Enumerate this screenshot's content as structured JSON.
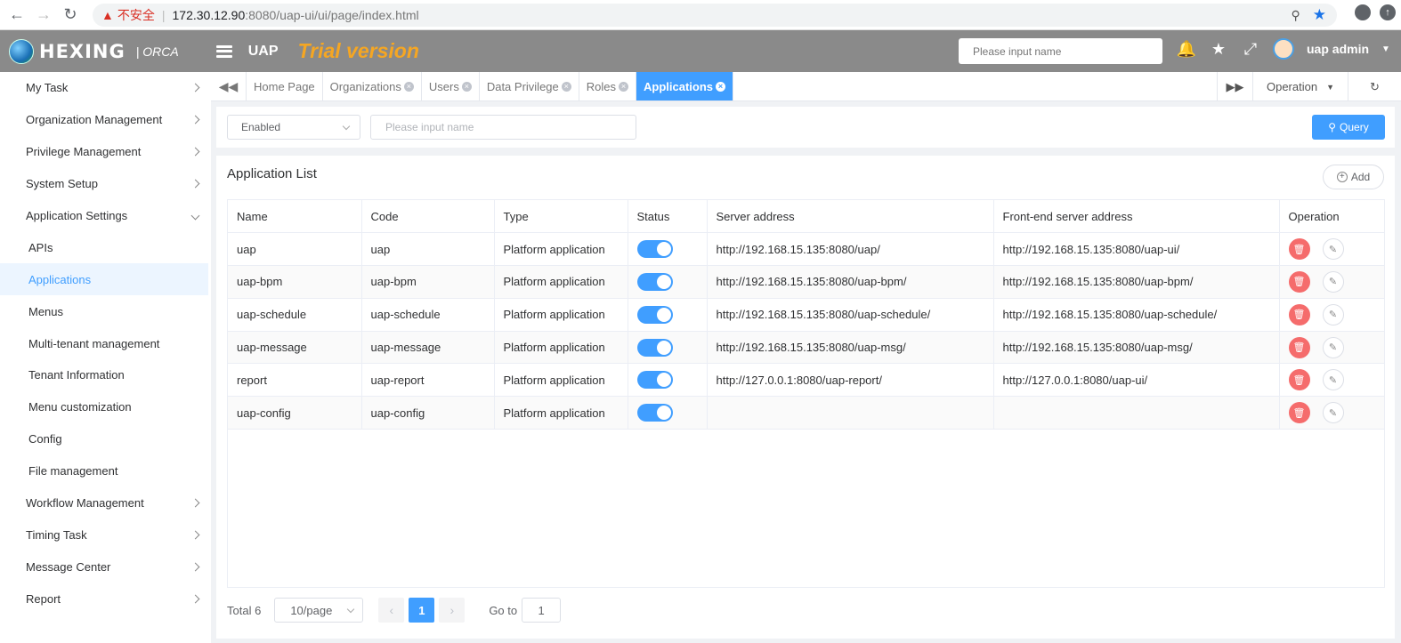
{
  "browser": {
    "insecure_label": "不安全",
    "url_host": "172.30.12.90",
    "url_path": ":8080/uap-ui/ui/page/index.html"
  },
  "header": {
    "brand": "HEXING",
    "brand_sub": "| ORCA",
    "app_name": "UAP",
    "trial": "Trial version",
    "search_placeholder": "Please input name",
    "user": "uap admin"
  },
  "sidebar": {
    "items": [
      {
        "label": "My Task",
        "type": "group"
      },
      {
        "label": "Organization Management",
        "type": "group"
      },
      {
        "label": "Privilege Management",
        "type": "group"
      },
      {
        "label": "System Setup",
        "type": "group"
      },
      {
        "label": "Application Settings",
        "type": "group-open"
      },
      {
        "label": "APIs",
        "type": "sub"
      },
      {
        "label": "Applications",
        "type": "sub-active"
      },
      {
        "label": "Menus",
        "type": "sub"
      },
      {
        "label": "Multi-tenant management",
        "type": "sub"
      },
      {
        "label": "Tenant Information",
        "type": "sub"
      },
      {
        "label": "Menu customization",
        "type": "sub"
      },
      {
        "label": "Config",
        "type": "sub"
      },
      {
        "label": "File management",
        "type": "sub"
      },
      {
        "label": "Workflow Management",
        "type": "group"
      },
      {
        "label": "Timing Task",
        "type": "group"
      },
      {
        "label": "Message Center",
        "type": "group"
      },
      {
        "label": "Report",
        "type": "group"
      }
    ]
  },
  "tabs": {
    "items": [
      {
        "label": "Home Page",
        "closable": false
      },
      {
        "label": "Organizations",
        "closable": true
      },
      {
        "label": "Users",
        "closable": true
      },
      {
        "label": "Data Privilege",
        "closable": true
      },
      {
        "label": "Roles",
        "closable": true
      },
      {
        "label": "Applications",
        "closable": true,
        "active": true
      }
    ],
    "operation_label": "Operation"
  },
  "filter": {
    "status_value": "Enabled",
    "name_placeholder": "Please input name",
    "query_label": "Query"
  },
  "panel": {
    "title": "Application List",
    "add_label": "Add",
    "columns": [
      "Name",
      "Code",
      "Type",
      "Status",
      "Server address",
      "Front-end server address",
      "Operation"
    ],
    "rows": [
      {
        "name": "uap",
        "code": "uap",
        "type": "Platform application",
        "enabled": true,
        "server": "http://192.168.15.135:8080/uap/",
        "frontend": "http://192.168.15.135:8080/uap-ui/"
      },
      {
        "name": "uap-bpm",
        "code": "uap-bpm",
        "type": "Platform application",
        "enabled": true,
        "server": "http://192.168.15.135:8080/uap-bpm/",
        "frontend": "http://192.168.15.135:8080/uap-bpm/"
      },
      {
        "name": "uap-schedule",
        "code": "uap-schedule",
        "type": "Platform application",
        "enabled": true,
        "server": "http://192.168.15.135:8080/uap-schedule/",
        "frontend": "http://192.168.15.135:8080/uap-schedule/"
      },
      {
        "name": "uap-message",
        "code": "uap-message",
        "type": "Platform application",
        "enabled": true,
        "server": "http://192.168.15.135:8080/uap-msg/",
        "frontend": "http://192.168.15.135:8080/uap-msg/"
      },
      {
        "name": "report",
        "code": "uap-report",
        "type": "Platform application",
        "enabled": true,
        "server": "http://127.0.0.1:8080/uap-report/",
        "frontend": "http://127.0.0.1:8080/uap-ui/"
      },
      {
        "name": "uap-config",
        "code": "uap-config",
        "type": "Platform application",
        "enabled": true,
        "server": "",
        "frontend": ""
      }
    ]
  },
  "pagination": {
    "total_label": "Total 6",
    "page_size": "10/page",
    "current_page": "1",
    "goto_label": "Go to",
    "goto_value": "1"
  },
  "colors": {
    "accent": "#409eff",
    "danger": "#f56c6c",
    "trial": "#f5a623",
    "header": "#8a8a8a"
  }
}
